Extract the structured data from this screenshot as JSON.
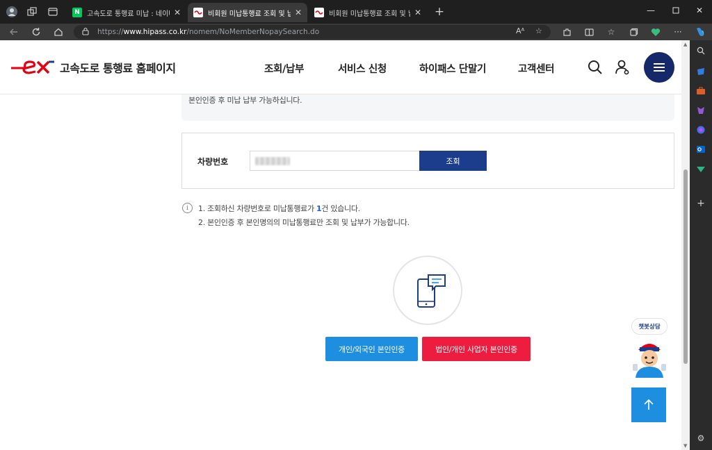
{
  "browser": {
    "tabs": [
      {
        "title": "고속도로 통행료 미납 : 네이버 통",
        "favicon": "N",
        "favicon_color": "#03c75a",
        "active": false
      },
      {
        "title": "비회원 미납통행료 조회 및 납부",
        "favicon": "ex",
        "favicon_color": "#ffffff",
        "active": true
      },
      {
        "title": "비회원 미납통행료 조회 및 납부",
        "favicon": "ex",
        "favicon_color": "#ffffff",
        "active": false
      }
    ],
    "new_tab": "+",
    "url_prefix": "https://",
    "url_host": "www.hipass.co.kr",
    "url_path": "/nomem/NoMemberNopaySearch.do"
  },
  "site": {
    "brand_name": "고속도로 통행료 홈페이지",
    "nav": [
      "조회/납부",
      "서비스 신청",
      "하이패스 단말기",
      "고객센터"
    ],
    "brand_color": "#e50012",
    "navy": "#15286a"
  },
  "notice_top": "본인인증 후 미납 납부 가능하십니다.",
  "search": {
    "label": "차량번호",
    "button": "조회"
  },
  "info": {
    "line1_before": "1. 조회하신 차량번호로 미납통행료가 ",
    "line1_count": "1",
    "line1_after": "건 있습니다.",
    "line2": "2. 본인인증 후 본인명의의 미납통행료만 조회 및 납부가 가능합니다."
  },
  "auth": {
    "personal": "개인/외국인 본인인증",
    "business": "법인/개인 사업자 본인인증"
  },
  "chatbot_label": "챗봇상담",
  "icons": [
    "search-icon",
    "user-icon",
    "menu-icon",
    "phone-chat-icon",
    "arrow-up-icon",
    "info-icon"
  ]
}
